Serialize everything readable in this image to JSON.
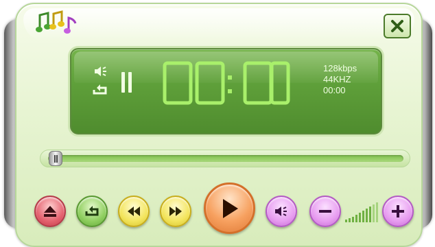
{
  "app": {
    "name": ""
  },
  "display": {
    "time": "00:00",
    "bitrate": "128kbps",
    "sample_rate": "44KHZ",
    "duration": "00:00",
    "state": "paused",
    "repeat_on": true,
    "sound_on": true
  },
  "seek": {
    "position": 0.0
  },
  "volume": {
    "level": 0.8,
    "bars": 10
  },
  "colors": {
    "body": "#e7f4d2",
    "display": "#5fa03a",
    "digits": "#a9f06b",
    "eject": "#e4626f",
    "repeat": "#8fcf5f",
    "skip": "#f3e55d",
    "play": "#f7a160",
    "volume": "#e79cf0"
  },
  "icons": {
    "logo": "music-notes-icon",
    "close": "close-icon",
    "eject": "eject-icon",
    "repeat": "repeat-icon",
    "rewind": "rewind-icon",
    "fast_forward": "fast-forward-icon",
    "play": "play-icon",
    "mute": "speaker-icon",
    "volume_down": "minus-icon",
    "volume_up": "plus-icon",
    "pause": "pause-icon"
  }
}
